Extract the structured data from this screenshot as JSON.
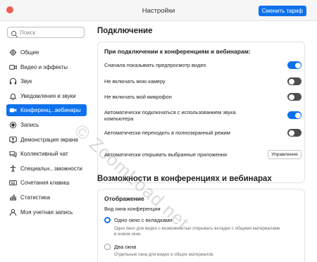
{
  "window": {
    "title": "Настройки",
    "upgrade_label": "Сменить тариф"
  },
  "search": {
    "placeholder": "Поиск"
  },
  "sidebar": {
    "items": [
      {
        "label": "Общие",
        "icon": "gear-icon"
      },
      {
        "label": "Видео и эффекты",
        "icon": "video-camera-icon"
      },
      {
        "label": "Звук",
        "icon": "headphones-icon"
      },
      {
        "label": "Уведомления и звуки",
        "icon": "bell-icon"
      },
      {
        "label": "Конференц...вебинары",
        "icon": "meeting-icon",
        "active": true
      },
      {
        "label": "Запись",
        "icon": "record-icon"
      },
      {
        "label": "Демонстрация экрана",
        "icon": "share-screen-icon"
      },
      {
        "label": "Коллективный чат",
        "icon": "chat-icon"
      },
      {
        "label": "Специальн...зможности",
        "icon": "accessibility-icon"
      },
      {
        "label": "Сочетания клавиш",
        "icon": "keyboard-icon"
      },
      {
        "label": "Статистика",
        "icon": "statistics-icon"
      },
      {
        "label": "Моя учетная запись",
        "icon": "account-icon"
      }
    ]
  },
  "connection": {
    "title": "Подключение",
    "subtitle": "При подключении к конференциям и вебинарам:",
    "options": [
      {
        "label": "Сначала показывать предпросмотр видео",
        "on": true
      },
      {
        "label": "Не включать мою камеру",
        "on": false
      },
      {
        "label": "Не включать мой микрофон",
        "on": false
      },
      {
        "label": "Автоматически подключаться с использованием звука компьютера",
        "on": true
      },
      {
        "label": "Автоматически переходить в полноэкранный режим",
        "on": false
      }
    ],
    "apps_label": "Автоматически открывать выбранные приложения",
    "manage_label": "Управление"
  },
  "features": {
    "title": "Возможности в конференциях и вебинарах",
    "display_title": "Отображение",
    "window_label": "Вид окна конференции",
    "radio_single_label": "Одно окно с вкладками",
    "radio_single_desc": "Одно окно для видео с возможностью открывать вкладки с общими материалами в новом окне.",
    "radio_two_label": "Два окна",
    "radio_two_desc": "Отдельные окна для видео и общих материалов.",
    "selected": "single"
  },
  "watermark": "© ZoomLoad.net",
  "colors": {
    "accent": "#0e72ed",
    "toggle_off": "#4d4d4d",
    "close_dot": "#ee5e55"
  }
}
